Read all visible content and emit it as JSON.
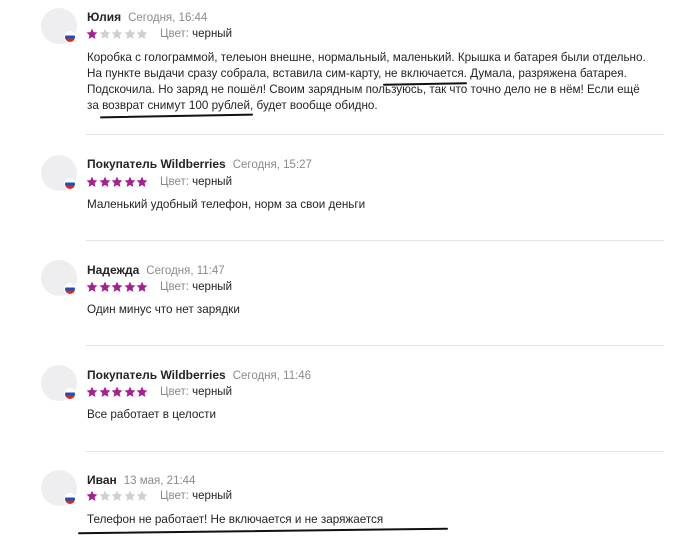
{
  "colors": {
    "star_filled": "#a4218f",
    "star_empty": "#d0d0d0",
    "muted": "#8b8b8b",
    "text": "#242424"
  },
  "reviews": [
    {
      "name": "Юлия",
      "date": "Сегодня, 16:44",
      "rating": 1,
      "color_label": "Цвет:",
      "color_value": "черный",
      "text_1": "Коробка с голограммой, телеыон внешне, нормальный, маленький. Крышка и батарея были отдельно. На пункте выдачи сразу собрала, вставила сим-карту, ",
      "text_2": "не включается",
      "text_3": ". Думала, разряжена батарея. Подскочила. Но заряд не пошёл! Своим зарядным пользуюсь, так что точно дело не в нём! Если ещё за ",
      "text_4": "возврат снимут 100 рублей",
      "text_5": ", будет вообще обидно."
    },
    {
      "name": "Покупатель Wildberries",
      "date": "Сегодня, 15:27",
      "rating": 5,
      "color_label": "Цвет:",
      "color_value": "черный",
      "text": "Маленький удобный телефон, норм за свои деньги"
    },
    {
      "name": "Надежда",
      "date": "Сегодня, 11:47",
      "rating": 5,
      "color_label": "Цвет:",
      "color_value": "черный",
      "text": "Один минус что нет зарядки"
    },
    {
      "name": "Покупатель Wildberries",
      "date": "Сегодня, 11:46",
      "rating": 5,
      "color_label": "Цвет:",
      "color_value": "черный",
      "text": "Все работает в целости"
    },
    {
      "name": "Иван",
      "date": "13 мая, 21:44",
      "rating": 1,
      "color_label": "Цвет:",
      "color_value": "черный",
      "text": "Телефон не работает! Не включается и не заряжается"
    }
  ]
}
